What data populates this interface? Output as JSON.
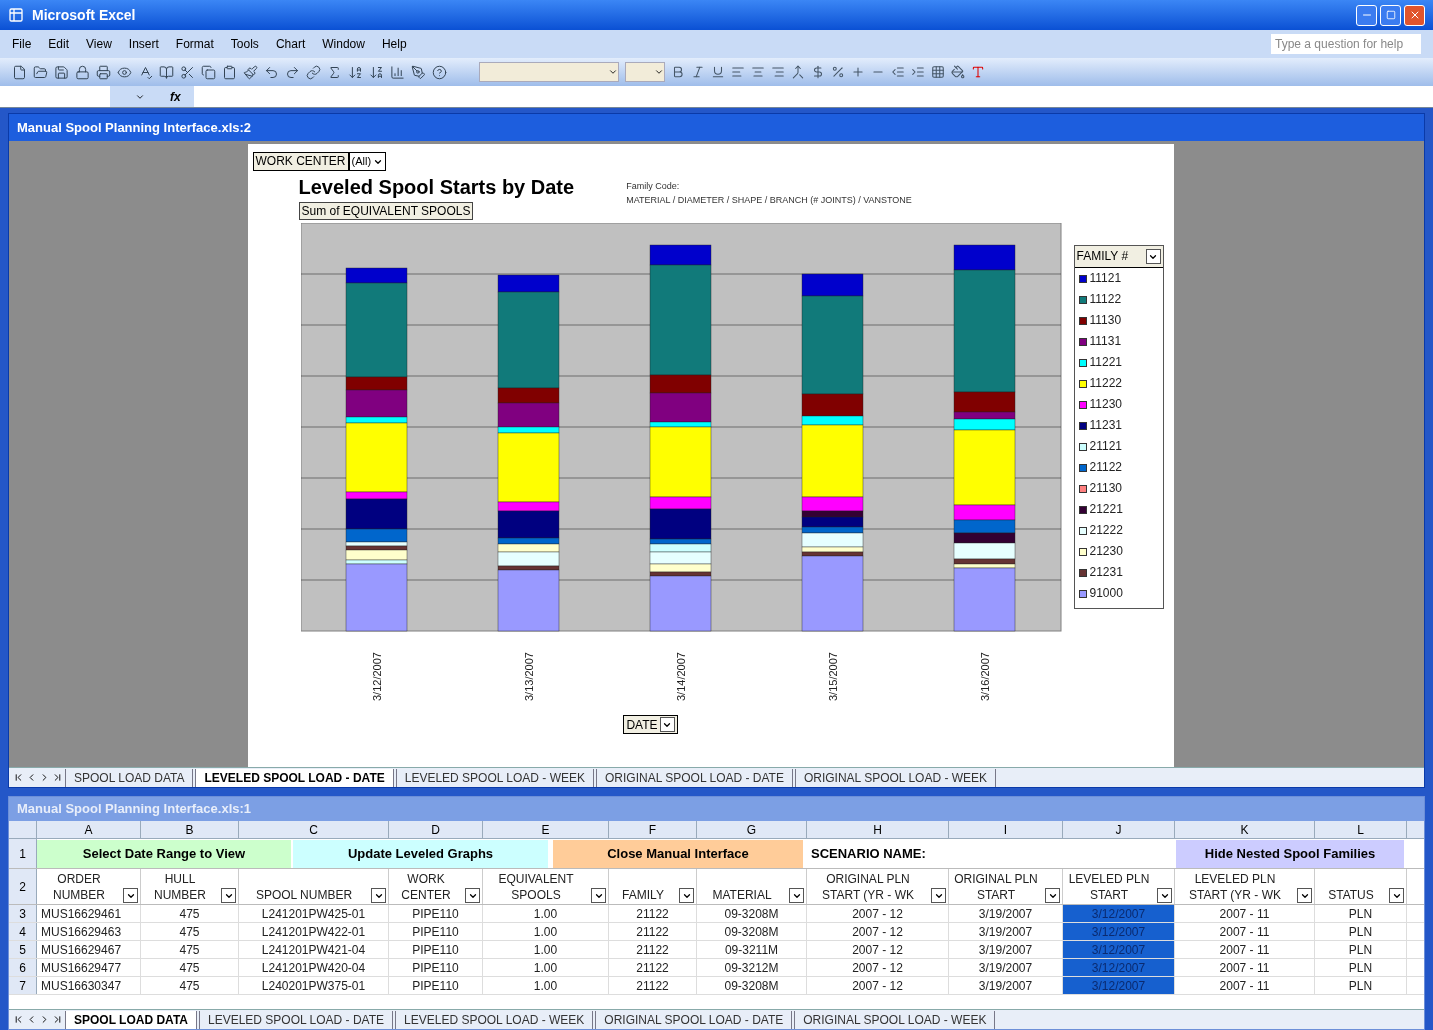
{
  "window": {
    "title": "Microsoft Excel"
  },
  "menu": [
    "File",
    "Edit",
    "View",
    "Insert",
    "Format",
    "Tools",
    "Chart",
    "Window",
    "Help"
  ],
  "help_box": {
    "placeholder": "Type a question for help"
  },
  "formula_bar": {
    "fx": "fx"
  },
  "chart_window": {
    "title": "Manual Spool Planning Interface.xls:2",
    "page_field": {
      "label": "WORK CENTER",
      "value": "(All)"
    },
    "chart": {
      "title": "Leveled Spool Starts by Date",
      "note_title": "Family Code:",
      "note": "MATERIAL / DIAMETER / SHAPE / BRANCH (# JOINTS) / VANSTONE",
      "data_field": "Sum of EQUIVALENT SPOOLS",
      "x_labels": [
        "3/12/2007",
        "3/13/2007",
        "3/14/2007",
        "3/15/2007",
        "3/16/2007"
      ],
      "category_field": "DATE",
      "legend": {
        "title": "FAMILY #",
        "items": [
          {
            "label": "11121",
            "color": "#0000cc"
          },
          {
            "label": "11122",
            "color": "#117a7a"
          },
          {
            "label": "11130",
            "color": "#800000"
          },
          {
            "label": "11131",
            "color": "#800080"
          },
          {
            "label": "11221",
            "color": "#00ffff"
          },
          {
            "label": "11222",
            "color": "#ffff00"
          },
          {
            "label": "11230",
            "color": "#ff00ff"
          },
          {
            "label": "11231",
            "color": "#000080"
          },
          {
            "label": "21121",
            "color": "#ccffff"
          },
          {
            "label": "21122",
            "color": "#0066cc"
          },
          {
            "label": "21130",
            "color": "#ff8080"
          },
          {
            "label": "21221",
            "color": "#330033"
          },
          {
            "label": "21222",
            "color": "#e6ffff"
          },
          {
            "label": "21230",
            "color": "#ffffcc"
          },
          {
            "label": "21231",
            "color": "#663333"
          },
          {
            "label": "91000",
            "color": "#9999ff"
          }
        ]
      }
    },
    "sheet_tabs": [
      {
        "label": "SPOOL LOAD DATA",
        "selected": false
      },
      {
        "label": "LEVELED SPOOL LOAD - DATE",
        "selected": true
      },
      {
        "label": "LEVELED SPOOL LOAD - WEEK",
        "selected": false
      },
      {
        "label": "ORIGINAL SPOOL LOAD - DATE",
        "selected": false
      },
      {
        "label": "ORIGINAL SPOOL LOAD - WEEK",
        "selected": false
      }
    ]
  },
  "data_window": {
    "title": "Manual Spool Planning Interface.xls:1",
    "column_letters": [
      "A",
      "B",
      "C",
      "D",
      "E",
      "F",
      "G",
      "H",
      "I",
      "J",
      "K",
      "L"
    ],
    "row1": {
      "number": "1",
      "buttons": [
        "Select Date Range to View",
        "Update Leveled Graphs",
        "Close Manual Interface"
      ],
      "scenario_label": "SCENARIO NAME:",
      "hide_button": "Hide Nested Spool Families"
    },
    "header_row_number": "2",
    "headers": [
      [
        "ORDER",
        "NUMBER"
      ],
      [
        "HULL",
        "NUMBER"
      ],
      [
        "SPOOL NUMBER"
      ],
      [
        "WORK",
        "CENTER"
      ],
      [
        "EQUIVALENT",
        "SPOOLS"
      ],
      [
        "FAMILY"
      ],
      [
        "MATERIAL"
      ],
      [
        "ORIGINAL PLN",
        "START (YR - WK"
      ],
      [
        "ORIGINAL PLN",
        "START"
      ],
      [
        "LEVELED PLN",
        "START"
      ],
      [
        "LEVELED PLN",
        "START (YR - WK"
      ],
      [
        "STATUS"
      ]
    ],
    "rows": [
      {
        "number": "3",
        "selected_leveled_start": true,
        "cells": [
          "MUS16629461",
          "475",
          "L241201PW425-01",
          "PIPE110",
          "1.00",
          "21122",
          "09-3208M",
          "2007 - 12",
          "3/19/2007",
          "3/12/2007",
          "2007 - 11",
          "PLN"
        ]
      },
      {
        "number": "4",
        "selected_leveled_start": true,
        "cells": [
          "MUS16629463",
          "475",
          "L241201PW422-01",
          "PIPE110",
          "1.00",
          "21122",
          "09-3208M",
          "2007 - 12",
          "3/19/2007",
          "3/12/2007",
          "2007 - 11",
          "PLN"
        ]
      },
      {
        "number": "5",
        "selected_leveled_start": true,
        "cells": [
          "MUS16629467",
          "475",
          "L241201PW421-04",
          "PIPE110",
          "1.00",
          "21122",
          "09-3211M",
          "2007 - 12",
          "3/19/2007",
          "3/12/2007",
          "2007 - 11",
          "PLN"
        ]
      },
      {
        "number": "6",
        "selected_leveled_start": true,
        "cells": [
          "MUS16629477",
          "475",
          "L241201PW420-04",
          "PIPE110",
          "1.00",
          "21122",
          "09-3212M",
          "2007 - 12",
          "3/19/2007",
          "3/12/2007",
          "2007 - 11",
          "PLN"
        ]
      },
      {
        "number": "7",
        "selected_leveled_start": true,
        "cells": [
          "MUS16630347",
          "475",
          "L240201PW375-01",
          "PIPE110",
          "1.00",
          "21122",
          "09-3208M",
          "2007 - 12",
          "3/19/2007",
          "3/12/2007",
          "2007 - 11",
          "PLN"
        ]
      }
    ],
    "sheet_tabs": [
      {
        "label": "SPOOL LOAD DATA",
        "selected": true
      },
      {
        "label": "LEVELED SPOOL LOAD - DATE",
        "selected": false
      },
      {
        "label": "LEVELED SPOOL LOAD - WEEK",
        "selected": false
      },
      {
        "label": "ORIGINAL SPOOL LOAD - DATE",
        "selected": false
      },
      {
        "label": "ORIGINAL SPOOL LOAD - WEEK",
        "selected": false
      }
    ]
  }
}
